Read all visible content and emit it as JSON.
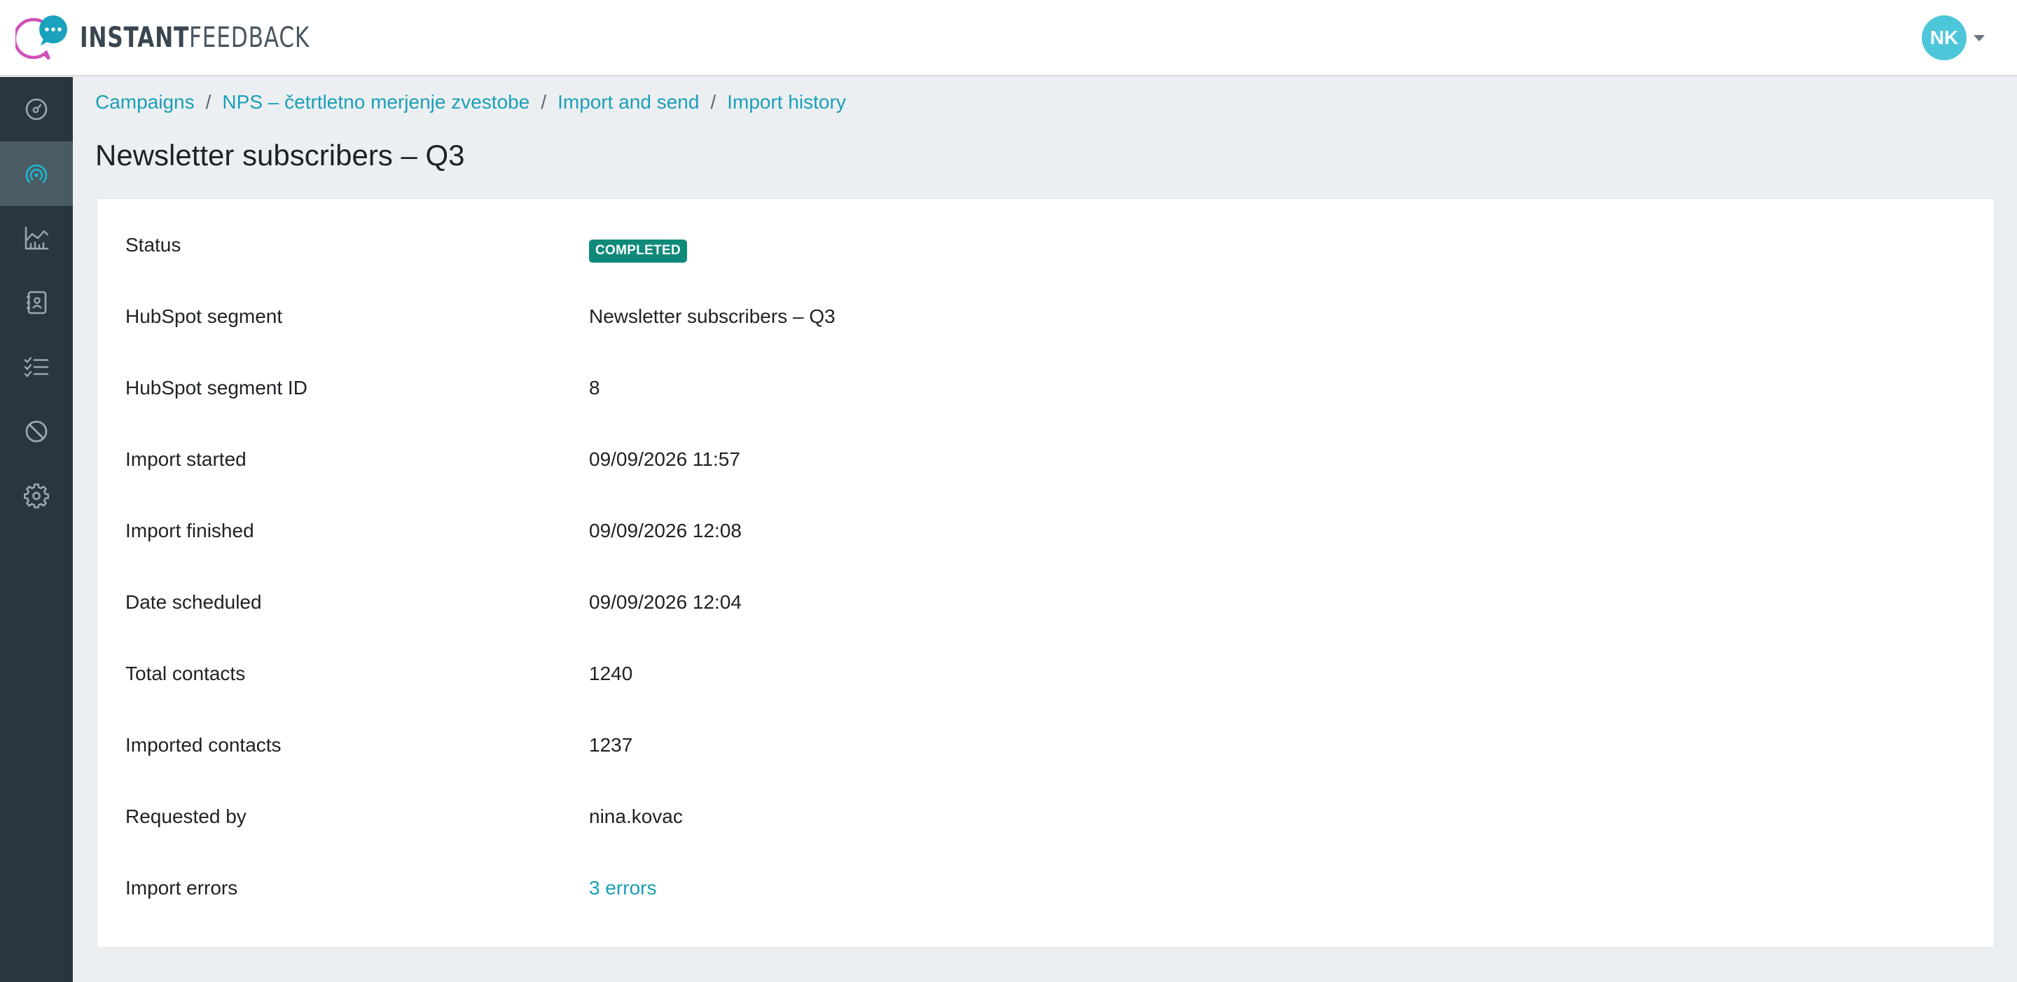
{
  "app": {
    "logo_strong": "INSTANT",
    "logo_light": "FEEDBACK",
    "brand_colors": {
      "accent": "#1a9fb8",
      "magenta": "#d14fb8",
      "sidebar": "#29363d"
    }
  },
  "user": {
    "initials": "NK",
    "avatar_color": "#4ec6d9"
  },
  "sidebar": {
    "items": [
      {
        "icon": "dashboard-gauge-icon",
        "active": false
      },
      {
        "icon": "campaigns-broadcast-icon",
        "active": true
      },
      {
        "icon": "analytics-chart-icon",
        "active": false
      },
      {
        "icon": "contacts-book-icon",
        "active": false
      },
      {
        "icon": "checklist-icon",
        "active": false
      },
      {
        "icon": "blocked-icon",
        "active": false
      },
      {
        "icon": "settings-gear-icon",
        "active": false
      }
    ]
  },
  "breadcrumb": {
    "items": [
      "Campaigns",
      "NPS – četrtletno merjenje zvestobe",
      "Import and send",
      "Import history"
    ],
    "separator": "/"
  },
  "page": {
    "title": "Newsletter subscribers – Q3"
  },
  "details": {
    "status_label": "Status",
    "status_value": "COMPLETED",
    "status_color": "#0f8a7a",
    "segment_label": "HubSpot segment",
    "segment_value": "Newsletter subscribers – Q3",
    "segment_id_label": "HubSpot segment ID",
    "segment_id_value": "8",
    "import_started_label": "Import started",
    "import_started_value": "09/09/2026 11:57",
    "import_finished_label": "Import finished",
    "import_finished_value": "09/09/2026 12:08",
    "date_scheduled_label": "Date scheduled",
    "date_scheduled_value": "09/09/2026 12:04",
    "total_contacts_label": "Total contacts",
    "total_contacts_value": "1240",
    "imported_contacts_label": "Imported contacts",
    "imported_contacts_value": "1237",
    "requested_by_label": "Requested by",
    "requested_by_value": "nina.kovac",
    "import_errors_label": "Import errors",
    "import_errors_value": "3 errors"
  }
}
